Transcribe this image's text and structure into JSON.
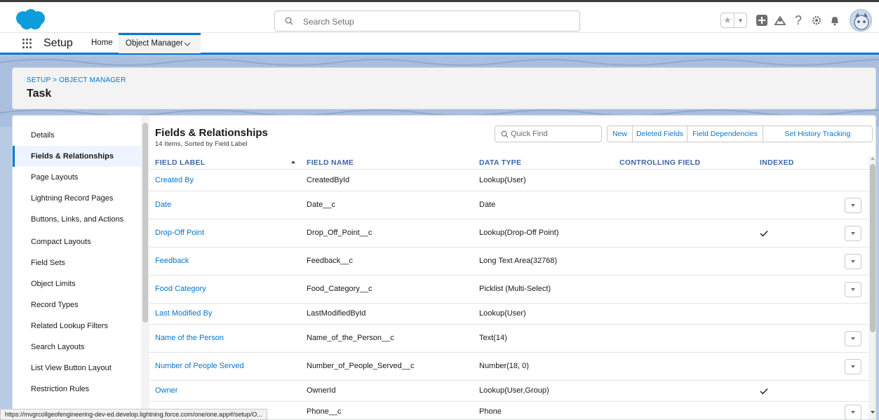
{
  "header": {
    "search_placeholder": "Search Setup"
  },
  "nav": {
    "app_name": "Setup",
    "tabs": [
      {
        "label": "Home"
      },
      {
        "label": "Object Manager"
      }
    ]
  },
  "page": {
    "breadcrumb": "SETUP > OBJECT MANAGER",
    "title": "Task"
  },
  "sidebar": {
    "items": [
      {
        "label": "Details"
      },
      {
        "label": "Fields & Relationships"
      },
      {
        "label": "Page Layouts"
      },
      {
        "label": "Lightning Record Pages"
      },
      {
        "label": "Buttons, Links, and Actions"
      },
      {
        "label": "Compact Layouts"
      },
      {
        "label": "Field Sets"
      },
      {
        "label": "Object Limits"
      },
      {
        "label": "Record Types"
      },
      {
        "label": "Related Lookup Filters"
      },
      {
        "label": "Search Layouts"
      },
      {
        "label": "List View Button Layout"
      },
      {
        "label": "Restriction Rules"
      }
    ],
    "active_index": 1
  },
  "fields": {
    "title": "Fields & Relationships",
    "subtitle": "14 Items, Sorted by Field Label",
    "quick_find_placeholder": "Quick Find",
    "buttons": {
      "new": "New",
      "deleted": "Deleted Fields",
      "dependencies": "Field Dependencies",
      "history": "Set History Tracking"
    },
    "columns": {
      "label": "FIELD LABEL",
      "name": "FIELD NAME",
      "type": "DATA TYPE",
      "controlling": "CONTROLLING FIELD",
      "indexed": "INDEXED"
    },
    "rows": [
      {
        "label": "Created By",
        "name": "CreatedById",
        "type": "Lookup(User)",
        "indexed": false,
        "menu": false
      },
      {
        "label": "Date",
        "name": "Date__c",
        "type": "Date",
        "indexed": false,
        "menu": true
      },
      {
        "label": "Drop-Off Point",
        "name": "Drop_Off_Point__c",
        "type": "Lookup(Drop-Off Point)",
        "indexed": true,
        "menu": true
      },
      {
        "label": "Feedback",
        "name": "Feedback__c",
        "type": "Long Text Area(32768)",
        "indexed": false,
        "menu": true
      },
      {
        "label": "Food Category",
        "name": "Food_Category__c",
        "type": "Picklist (Multi-Select)",
        "indexed": false,
        "menu": true
      },
      {
        "label": "Last Modified By",
        "name": "LastModifiedById",
        "type": "Lookup(User)",
        "indexed": false,
        "menu": false
      },
      {
        "label": "Name of the Person",
        "name": "Name_of_the_Person__c",
        "type": "Text(14)",
        "indexed": false,
        "menu": true
      },
      {
        "label": "Number of People Served",
        "name": "Number_of_People_Served__c",
        "type": "Number(18, 0)",
        "indexed": false,
        "menu": true
      },
      {
        "label": "Owner",
        "name": "OwnerId",
        "type": "Lookup(User,Group)",
        "indexed": true,
        "menu": false
      },
      {
        "label": "",
        "name": "Phone__c",
        "type": "Phone",
        "indexed": false,
        "menu": true
      }
    ]
  },
  "status_url": "https://mvgrcollgeofengineering-dev-ed.develop.lightning.force.com/one/one.app#/setup/O..."
}
